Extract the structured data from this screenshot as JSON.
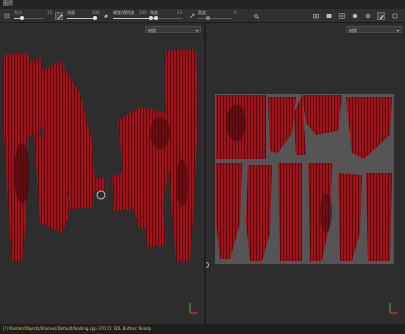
{
  "titlebar": {
    "title": "图层"
  },
  "toolbar": {
    "size_label": "大小",
    "size_value": "15",
    "size_fill": 0.27,
    "opacity_label": "流量",
    "opacity_value": "100",
    "opacity_fill": 1.0,
    "soft_label": "硬度/透明度",
    "soft_value": "100",
    "soft_fill": 1.0,
    "angle_label": "角度",
    "angle_value": "23",
    "angle_fill": 0.18,
    "extra_label": "宽度",
    "extra_value": "0",
    "extra_fill": 0.0,
    "accent": "#c8c8c8"
  },
  "viewport_left": {
    "mode_label": "材质"
  },
  "viewport_right": {
    "mode_label": "材质"
  },
  "colors": {
    "fabric": "#a0121a",
    "fabric_dark": "#5a0a0e",
    "panel_bg": "#2d2d2d",
    "uv_bg": "#555555"
  },
  "statusbar": {
    "text": "[!] Painter/Objects/Shelves/Default/loading.spp 370 Cl: SDL Button: Ready"
  },
  "icons": [
    "pan-icon",
    "brush-icon",
    "eraser-icon",
    "projection-icon",
    "fill-icon",
    "picker-icon",
    "camera-icon",
    "camera-view-icon",
    "grid-icon",
    "record-icon",
    "settings-icon",
    "brush-active-icon",
    "expand-icon"
  ]
}
